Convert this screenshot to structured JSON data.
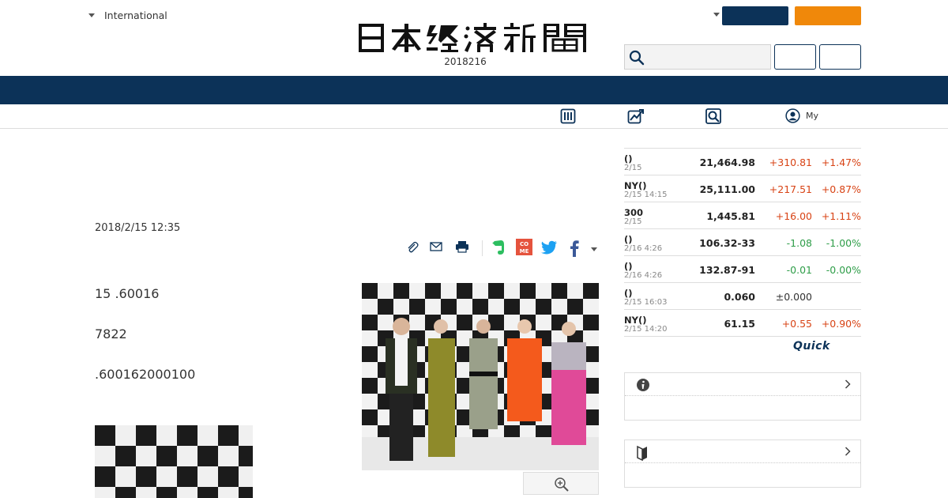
{
  "header": {
    "region_label": "International",
    "date": "2018216"
  },
  "colors": {
    "navy": "#0c3258",
    "orange": "#f0880a",
    "positive": "#d84315",
    "negative": "#2e9d48"
  },
  "subnav": {
    "my_label": "My"
  },
  "article": {
    "date": "2018/2/15 12:35",
    "paragraphs": [
      "15 .60016",
      "7822",
      ".600162000100"
    ]
  },
  "markets": [
    {
      "name": "()",
      "time": "2/15",
      "value": "21,464.98",
      "change": "+310.81",
      "pct": "+1.47%",
      "dir": "up"
    },
    {
      "name": "NY()",
      "time": "2/15 14:15",
      "value": "25,111.00",
      "change": "+217.51",
      "pct": "+0.87%",
      "dir": "up"
    },
    {
      "name": "300",
      "time": "2/15",
      "value": "1,445.81",
      "change": "+16.00",
      "pct": "+1.11%",
      "dir": "up"
    },
    {
      "name": "()",
      "time": "2/16 4:26",
      "value": "106.32-33",
      "change": "-1.08",
      "pct": "-1.00%",
      "dir": "down"
    },
    {
      "name": "()",
      "time": "2/16 4:26",
      "value": "132.87-91",
      "change": "-0.01",
      "pct": "-0.00%",
      "dir": "down"
    },
    {
      "name": "()",
      "time": "2/15 16:03",
      "value": "0.060",
      "change": "±0.000",
      "pct": "",
      "dir": "flat"
    },
    {
      "name": "NY()",
      "time": "2/15 14:20",
      "value": "61.15",
      "change": "+0.55",
      "pct": "+0.90%",
      "dir": "up"
    }
  ],
  "quick_logo": "Quick",
  "icons": [
    "caret-down",
    "search",
    "grid",
    "chart",
    "magnifier",
    "person",
    "paperclip",
    "mail",
    "printer",
    "evernote",
    "comemo",
    "twitter",
    "facebook",
    "zoom",
    "info",
    "chevron-right",
    "bookmark"
  ]
}
